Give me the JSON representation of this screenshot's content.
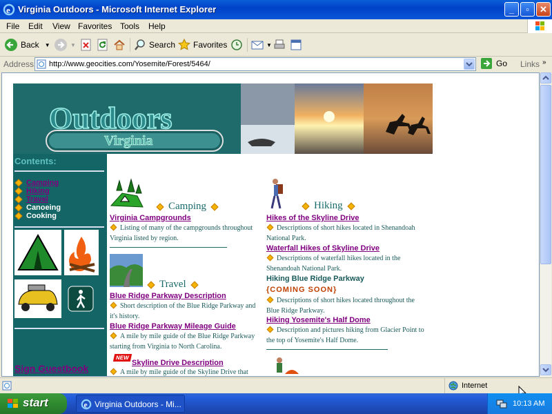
{
  "window": {
    "title": "Virginia Outdoors - Microsoft Internet Explorer"
  },
  "menu": [
    "File",
    "Edit",
    "View",
    "Favorites",
    "Tools",
    "Help"
  ],
  "toolbar": {
    "back": "Back",
    "search": "Search",
    "favorites": "Favorites"
  },
  "address": {
    "label": "Address",
    "url": "http://www.geocities.com/Yosemite/Forest/5464/",
    "go": "Go",
    "links": "Links"
  },
  "status": {
    "zone": "Internet"
  },
  "taskbar": {
    "start": "start",
    "task": "Virginia Outdoors - Mi...",
    "clock": "10:13 AM"
  },
  "page": {
    "banner": {
      "line1": "Outdoors",
      "line2": "Virginia"
    },
    "contents_heading": "Contents:",
    "nav": [
      {
        "label": "Camping",
        "link": true
      },
      {
        "label": "Hiking",
        "link": true
      },
      {
        "label": "Travel",
        "link": true
      },
      {
        "label": "Canoeing",
        "link": false
      },
      {
        "label": "Cooking",
        "link": false
      }
    ],
    "guestbook": "Sign Guestbook",
    "camping": {
      "heading": "Camping",
      "link1": "Virginia Campgrounds",
      "desc1": "Listing of many of the campgrounds throughout Virginia listed by region."
    },
    "travel": {
      "heading": "Travel",
      "link1": "Blue Ridge Parkway Description",
      "desc1": "Short description of the Blue Ridge Parkway and it's history.",
      "link2": "Blue Ridge Parkway Mileage Guide",
      "desc2": "A mile by mile guide of the Blue Ridge Parkway starting from Virginia to North Carolina.",
      "new_badge": "NEW",
      "link3": "Skyline Drive Description",
      "desc3": "A mile by mile guide of the Skyline Drive that"
    },
    "hiking": {
      "heading": "Hiking",
      "link1": "Hikes of the Skyline Drive",
      "desc1": "Descriptions of short hikes located in Shenandoah National Park.",
      "link2": "Waterfall Hikes of Skyline Drive",
      "desc2": "Descriptions of waterfall hikes located in the Shenandoah National Park.",
      "plain3": "Hiking Blue Ridge Parkway",
      "soon": "{COMING SOON}",
      "desc3": "Descriptions of short hikes located throughout the Blue Ridge Parkway.",
      "link4": "Hiking Yosemite's Half Dome",
      "desc4": "Description and pictures hiking from Glacier Point to the top of Yosemite's Half Dome."
    }
  },
  "colors": {
    "titlebar": "#0042c8",
    "teal": "#146565",
    "visited_link": "#800080",
    "accent_diamond": "#f4b400"
  }
}
